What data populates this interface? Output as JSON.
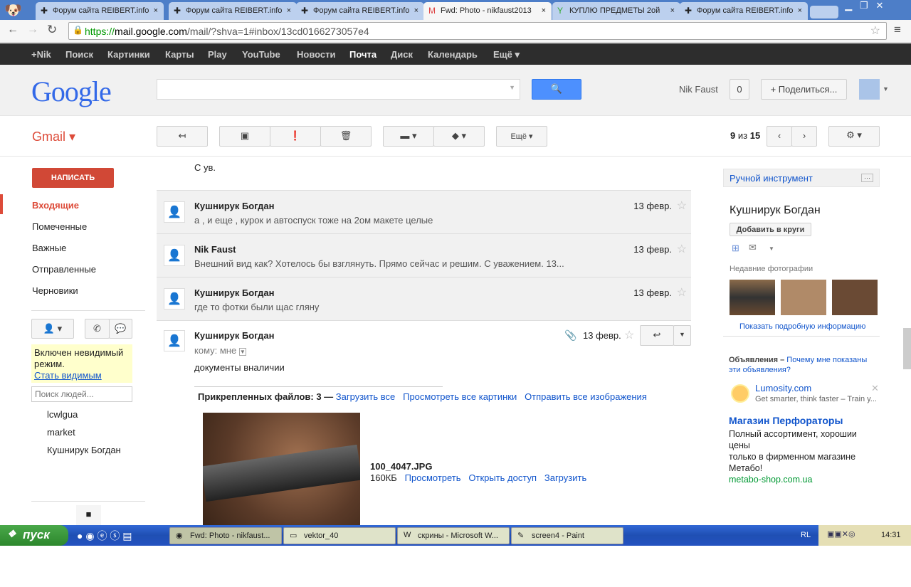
{
  "browser": {
    "tabs": [
      {
        "title": "Форум сайта REIBERT.info"
      },
      {
        "title": "Форум сайта REIBERT.info"
      },
      {
        "title": "Форум сайта REIBERT.info"
      },
      {
        "title": "Fwd: Photo - nikfaust2013"
      },
      {
        "title": "КУПЛЮ ПРЕДМЕТЫ 2ой"
      },
      {
        "title": "Форум сайта REIBERT.info"
      }
    ],
    "url_scheme": "https://",
    "url_host": "mail.google.com",
    "url_path": "/mail/?shva=1#inbox/13cd0166273057e4"
  },
  "gbar": [
    "+Nik",
    "Поиск",
    "Картинки",
    "Карты",
    "Play",
    "YouTube",
    "Новости",
    "Почта",
    "Диск",
    "Календарь",
    "Ещё ▾"
  ],
  "header": {
    "logo": "Google",
    "user": "Nik Faust",
    "notif": "0",
    "share": "+ Поделиться..."
  },
  "gmail": {
    "label": "Gmail ▾",
    "more": "Ещё ▾",
    "count_current": "9",
    "count_of": "из",
    "count_total": "15"
  },
  "sidebar": {
    "compose": "НАПИСАТЬ",
    "items": [
      "Входящие",
      "Помеченные",
      "Важные",
      "Отправленные",
      "Черновики"
    ],
    "invisible": "Включен невидимый режим.",
    "be_visible": "Стать видимым",
    "people_placeholder": "Поиск людей...",
    "contacts": [
      "lcwlgua",
      "market",
      "Кушнирук Богдан"
    ]
  },
  "thread": {
    "prev_text": "С ув.",
    "messages": [
      {
        "sender": "Кушнирук Богдан",
        "snippet": "а , и еще , курок и автоспуск тоже на 2ом макете целые",
        "date": "13 февр."
      },
      {
        "sender": "Nik Faust",
        "snippet": "Внешний вид как? Хотелось бы взглянуть. Прямо сейчас и решим. С уважением. 13...",
        "date": "13 февр."
      },
      {
        "sender": "Кушнирук Богдан",
        "snippet": "где то фотки были щас гляну",
        "date": "13 февр."
      }
    ],
    "open": {
      "sender": "Кушнирук Богдан",
      "date": "13 февр.",
      "to": "кому: мне",
      "body": "документы вналичии",
      "attach_label": "Прикрепленных файлов: 3 —",
      "download_all": "Загрузить все",
      "view_all": "Просмотреть все картинки",
      "send_all": "Отправить все изображения",
      "file_name": "100_4047.JPG",
      "file_size": "160КБ",
      "view": "Просмотреть",
      "share": "Открыть доступ",
      "download": "Загрузить"
    }
  },
  "right": {
    "tool": "Ручной инструмент",
    "name": "Кушнирук Богдан",
    "add": "Добавить в круги",
    "recent": "Недавние фотографии",
    "details": "Показать подробную информацию",
    "ads": "Объявления –",
    "why": "Почему мне показаны эти объявления?",
    "ad1_title": "Lumosity.com",
    "ad1_text": "Get smarter, think faster – Train y...",
    "ad2_title": "Магазин Перфораторы",
    "ad2_text": "Полный ассортимент, хорошии цены",
    "ad2_text2": "только в фирменном магазине Метабо!",
    "ad2_url": "metabo-shop.com.ua"
  },
  "taskbar": {
    "start": "пуск",
    "items": [
      "Fwd: Photo - nikfaust...",
      "vektor_40",
      "скрины - Microsoft W...",
      "screen4 - Paint"
    ],
    "lang": "RL",
    "clock": "14:31"
  }
}
